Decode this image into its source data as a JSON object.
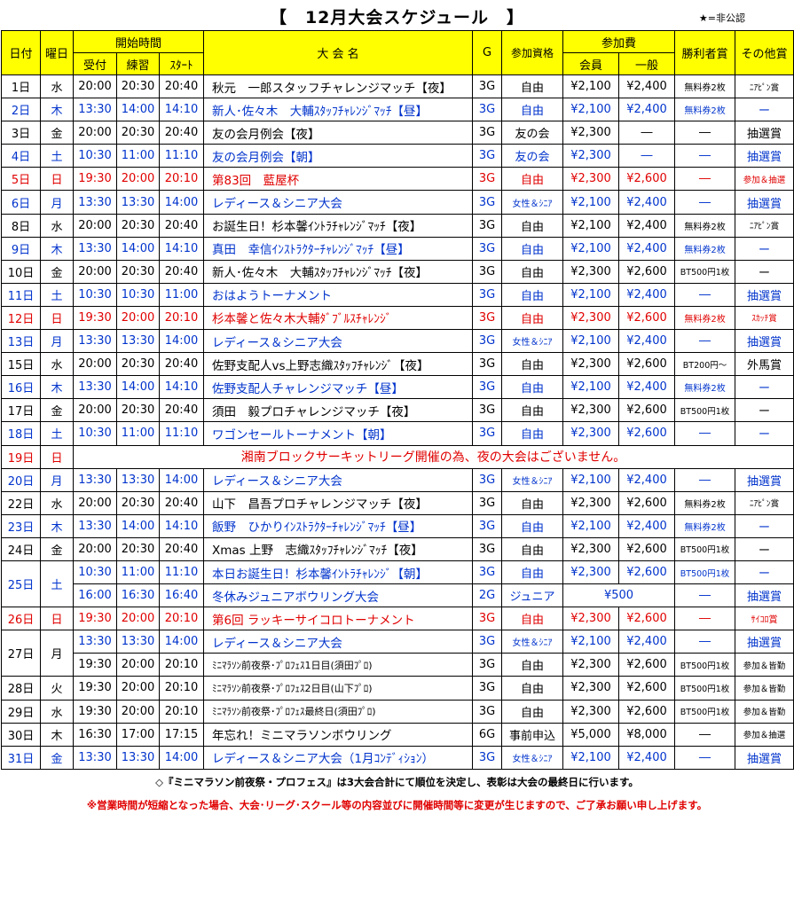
{
  "title": "【　12月大会スケジュール　】",
  "note": "★=非公認",
  "headers": {
    "date": "日付",
    "dow": "曜日",
    "start": "開始時間",
    "reception": "受付",
    "practice": "練習",
    "start_time": "ｽﾀｰﾄ",
    "name": "大 会 名",
    "g": "G",
    "qual": "参加資格",
    "fee": "参加費",
    "member": "会員",
    "general": "一般",
    "winner": "勝利者賞",
    "other": "その他賞"
  },
  "rows": [
    {
      "date": "1日",
      "dow": "水",
      "r": "20:00",
      "p": "20:30",
      "s": "20:40",
      "name": "秋元　一郎スタッフチャレンジマッチ【夜】",
      "g": "3G",
      "q": "自由",
      "m": "¥2,100",
      "gen": "¥2,400",
      "w": "無料券2枚",
      "o": "ﾆｱﾋﾟﾝ賞",
      "color": "black"
    },
    {
      "date": "2日",
      "dow": "木",
      "r": "13:30",
      "p": "14:00",
      "s": "14:10",
      "name": "新人･佐々木　大輔ｽﾀｯﾌﾁｬﾚﾝｼﾞﾏｯﾁ【昼】",
      "g": "3G",
      "q": "自由",
      "m": "¥2,100",
      "gen": "¥2,400",
      "w": "無料券2枚",
      "o": "ー",
      "color": "blue"
    },
    {
      "date": "3日",
      "dow": "金",
      "r": "20:00",
      "p": "20:30",
      "s": "20:40",
      "name": "友の会月例会【夜】",
      "g": "3G",
      "q": "友の会",
      "m": "¥2,300",
      "gen": "―",
      "w": "―",
      "o": "抽選賞",
      "color": "black"
    },
    {
      "date": "4日",
      "dow": "土",
      "r": "10:30",
      "p": "11:00",
      "s": "11:10",
      "name": "友の会月例会【朝】",
      "g": "3G",
      "q": "友の会",
      "m": "¥2,300",
      "gen": "―",
      "w": "―",
      "o": "抽選賞",
      "color": "blue"
    },
    {
      "date": "5日",
      "dow": "日",
      "r": "19:30",
      "p": "20:00",
      "s": "20:10",
      "name": "第83回　藍屋杯",
      "g": "3G",
      "q": "自由",
      "m": "¥2,300",
      "gen": "¥2,600",
      "w": "―",
      "o": "参加＆抽選",
      "color": "red"
    },
    {
      "date": "6日",
      "dow": "月",
      "r": "13:30",
      "p": "13:30",
      "s": "14:00",
      "name": "レディース＆シニア大会",
      "g": "3G",
      "q": "女性＆ｼﾆｱ",
      "m": "¥2,100",
      "gen": "¥2,400",
      "w": "―",
      "o": "抽選賞",
      "color": "blue"
    },
    {
      "date": "8日",
      "dow": "水",
      "r": "20:00",
      "p": "20:30",
      "s": "20:40",
      "name": "お誕生日！杉本馨ｲﾝﾄﾗﾁｬﾚﾝｼﾞﾏｯﾁ【夜】",
      "g": "3G",
      "q": "自由",
      "m": "¥2,100",
      "gen": "¥2,400",
      "w": "無料券2枚",
      "o": "ﾆｱﾋﾟﾝ賞",
      "color": "black"
    },
    {
      "date": "9日",
      "dow": "木",
      "r": "13:30",
      "p": "14:00",
      "s": "14:10",
      "name": "真田　幸信ｲﾝｽﾄﾗｸﾀｰﾁｬﾚﾝｼﾞﾏｯﾁ【昼】",
      "g": "3G",
      "q": "自由",
      "m": "¥2,100",
      "gen": "¥2,400",
      "w": "無料券2枚",
      "o": "ー",
      "color": "blue"
    },
    {
      "date": "10日",
      "dow": "金",
      "r": "20:00",
      "p": "20:30",
      "s": "20:40",
      "name": "新人･佐々木　大輔ｽﾀｯﾌﾁｬﾚﾝｼﾞﾏｯﾁ【夜】",
      "g": "3G",
      "q": "自由",
      "m": "¥2,300",
      "gen": "¥2,600",
      "w": "BT500円1枚",
      "o": "ー",
      "color": "black"
    },
    {
      "date": "11日",
      "dow": "土",
      "r": "10:30",
      "p": "10:30",
      "s": "11:00",
      "name": "おはようトーナメント",
      "g": "3G",
      "q": "自由",
      "m": "¥2,100",
      "gen": "¥2,400",
      "w": "―",
      "o": "抽選賞",
      "color": "blue"
    },
    {
      "date": "12日",
      "dow": "日",
      "r": "19:30",
      "p": "20:00",
      "s": "20:10",
      "name": "杉本馨と佐々木大輔ﾀﾞﾌﾞﾙｽﾁｬﾚﾝｼﾞ",
      "g": "3G",
      "q": "自由",
      "m": "¥2,300",
      "gen": "¥2,600",
      "w": "無料券2枚",
      "o": "ｽｶｯﾁ賞",
      "color": "red"
    },
    {
      "date": "13日",
      "dow": "月",
      "r": "13:30",
      "p": "13:30",
      "s": "14:00",
      "name": "レディース＆シニア大会",
      "g": "3G",
      "q": "女性＆ｼﾆｱ",
      "m": "¥2,100",
      "gen": "¥2,400",
      "w": "―",
      "o": "抽選賞",
      "color": "blue"
    },
    {
      "date": "15日",
      "dow": "水",
      "r": "20:00",
      "p": "20:30",
      "s": "20:40",
      "name": "佐野支配人vs上野志織ｽﾀｯﾌﾁｬﾚﾝｼﾞ【夜】",
      "g": "3G",
      "q": "自由",
      "m": "¥2,300",
      "gen": "¥2,600",
      "w": "BT200円～",
      "o": "外馬賞",
      "color": "black"
    },
    {
      "date": "16日",
      "dow": "木",
      "r": "13:30",
      "p": "14:00",
      "s": "14:10",
      "name": "佐野支配人チャレンジマッチ【昼】",
      "g": "3G",
      "q": "自由",
      "m": "¥2,100",
      "gen": "¥2,400",
      "w": "無料券2枚",
      "o": "ー",
      "color": "blue"
    },
    {
      "date": "17日",
      "dow": "金",
      "r": "20:00",
      "p": "20:30",
      "s": "20:40",
      "name": "須田　毅プロチャレンジマッチ【夜】",
      "g": "3G",
      "q": "自由",
      "m": "¥2,300",
      "gen": "¥2,600",
      "w": "BT500円1枚",
      "o": "ー",
      "color": "black"
    },
    {
      "date": "18日",
      "dow": "土",
      "r": "10:30",
      "p": "11:00",
      "s": "11:10",
      "name": "ワゴンセールトーナメント【朝】",
      "g": "3G",
      "q": "自由",
      "m": "¥2,300",
      "gen": "¥2,600",
      "w": "―",
      "o": "ー",
      "color": "blue"
    }
  ],
  "notice_row": {
    "date": "19日",
    "dow": "日",
    "text": "湘南ブロックサーキットリーグ開催の為、夜の大会はございません。"
  },
  "rows2": [
    {
      "date": "20日",
      "dow": "月",
      "r": "13:30",
      "p": "13:30",
      "s": "14:00",
      "name": "レディース＆シニア大会",
      "g": "3G",
      "q": "女性＆ｼﾆｱ",
      "m": "¥2,100",
      "gen": "¥2,400",
      "w": "―",
      "o": "抽選賞",
      "color": "blue"
    },
    {
      "date": "22日",
      "dow": "水",
      "r": "20:00",
      "p": "20:30",
      "s": "20:40",
      "name": "山下　昌吾プロチャレンジマッチ【夜】",
      "g": "3G",
      "q": "自由",
      "m": "¥2,300",
      "gen": "¥2,600",
      "w": "無料券2枚",
      "o": "ﾆｱﾋﾟﾝ賞",
      "color": "black"
    },
    {
      "date": "23日",
      "dow": "木",
      "r": "13:30",
      "p": "14:00",
      "s": "14:10",
      "name": "飯野　ひかりｲﾝｽﾄﾗｸﾀｰﾁｬﾚﾝｼﾞﾏｯﾁ【昼】",
      "g": "3G",
      "q": "自由",
      "m": "¥2,100",
      "gen": "¥2,400",
      "w": "無料券2枚",
      "o": "ー",
      "color": "blue"
    },
    {
      "date": "24日",
      "dow": "金",
      "r": "20:00",
      "p": "20:30",
      "s": "20:40",
      "name": "Xmas 上野　志織ｽﾀｯﾌﾁｬﾚﾝｼﾞﾏｯﾁ【夜】",
      "g": "3G",
      "q": "自由",
      "m": "¥2,300",
      "gen": "¥2,600",
      "w": "BT500円1枚",
      "o": "ー",
      "color": "black"
    }
  ],
  "day25": {
    "date": "25日",
    "dow": "土",
    "a": {
      "r": "10:30",
      "p": "11:00",
      "s": "11:10",
      "name": "本日お誕生日！杉本馨ｲﾝﾄﾗﾁｬﾚﾝｼﾞ【朝】",
      "g": "3G",
      "q": "自由",
      "m": "¥2,300",
      "gen": "¥2,600",
      "w": "BT500円1枚",
      "o": "ー"
    },
    "b": {
      "r": "16:00",
      "p": "16:30",
      "s": "16:40",
      "name": "冬休みジュニアボウリング大会",
      "g": "2G",
      "q": "ジュニア",
      "fee": "¥500",
      "w": "―",
      "o": "抽選賞"
    }
  },
  "day26": {
    "date": "26日",
    "dow": "日",
    "r": "19:30",
    "p": "20:00",
    "s": "20:10",
    "name": "第6回 ラッキーサイコロトーナメント",
    "g": "3G",
    "q": "自由",
    "m": "¥2,300",
    "gen": "¥2,600",
    "w": "―",
    "o": "ｻｲｺﾛ賞"
  },
  "day27": {
    "date": "27日",
    "dow": "月",
    "a": {
      "r": "13:30",
      "p": "13:30",
      "s": "14:00",
      "name": "レディース＆シニア大会",
      "g": "3G",
      "q": "女性＆ｼﾆｱ",
      "m": "¥2,100",
      "gen": "¥2,400",
      "w": "―",
      "o": "抽選賞"
    },
    "b": {
      "r": "19:30",
      "p": "20:00",
      "s": "20:10",
      "name": "ﾐﾆﾏﾗｿﾝ前夜祭･ﾌﾟﾛﾌｪｽ1日目(須田ﾌﾟﾛ)",
      "g": "3G",
      "q": "自由",
      "m": "¥2,300",
      "gen": "¥2,600",
      "w": "BT500円1枚",
      "o": "参加＆皆勤"
    }
  },
  "rows3": [
    {
      "date": "28日",
      "dow": "火",
      "r": "19:30",
      "p": "20:00",
      "s": "20:10",
      "name": "ﾐﾆﾏﾗｿﾝ前夜祭･ﾌﾟﾛﾌｪｽ2日目(山下ﾌﾟﾛ)",
      "g": "3G",
      "q": "自由",
      "m": "¥2,300",
      "gen": "¥2,600",
      "w": "BT500円1枚",
      "o": "参加＆皆勤",
      "color": "black"
    },
    {
      "date": "29日",
      "dow": "水",
      "r": "19:30",
      "p": "20:00",
      "s": "20:10",
      "name": "ﾐﾆﾏﾗｿﾝ前夜祭･ﾌﾟﾛﾌｪｽ最終日(須田ﾌﾟﾛ)",
      "g": "3G",
      "q": "自由",
      "m": "¥2,300",
      "gen": "¥2,600",
      "w": "BT500円1枚",
      "o": "参加＆皆勤",
      "color": "black"
    },
    {
      "date": "30日",
      "dow": "木",
      "r": "16:30",
      "p": "17:00",
      "s": "17:15",
      "name": "年忘れ！ミニマラソンボウリング",
      "g": "6G",
      "q": "事前申込",
      "m": "¥5,000",
      "gen": "¥8,000",
      "w": "―",
      "o": "参加＆抽選",
      "color": "black"
    },
    {
      "date": "31日",
      "dow": "金",
      "r": "13:30",
      "p": "13:30",
      "s": "14:00",
      "name": "レディース＆シニア大会（1月ｺﾝﾃﾞｨｼｮﾝ）",
      "g": "3G",
      "q": "女性＆ｼﾆｱ",
      "m": "¥2,100",
      "gen": "¥2,400",
      "w": "―",
      "o": "抽選賞",
      "color": "blue"
    }
  ],
  "footer1": "◇『ミニマラソン前夜祭・プロフェス』は3大会合計にて順位を決定し、表彰は大会の最終日に行います。",
  "footer2": "※営業時間が短縮となった場合、大会･リーグ･スクール等の内容並びに開催時間等に変更が生じますので、ご了承お願い申し上げます。"
}
